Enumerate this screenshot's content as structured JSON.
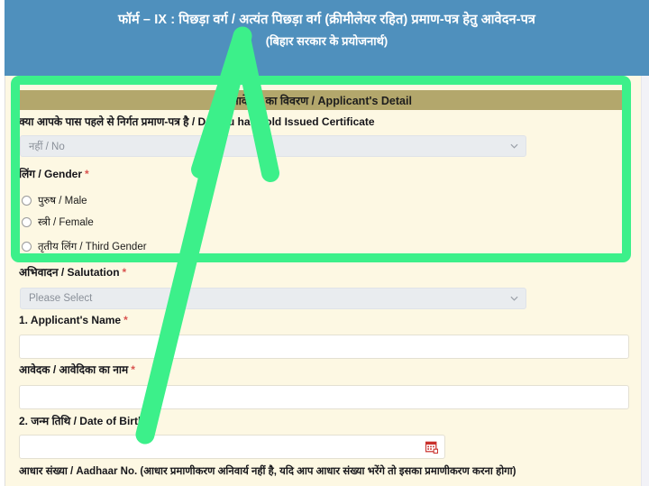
{
  "banner": {
    "title_line1": "फॉर्म – IX : पिछड़ा वर्ग / अत्यंत पिछड़ा वर्ग (क्रीमीलेयर रहित) प्रमाण-पत्र हेतु आवेदन-पत्र",
    "title_line2": "(बिहार सरकार के प्रयोजनार्थ)"
  },
  "section": {
    "header": "आवेदक का विवरण / Applicant's Detail"
  },
  "form": {
    "old_certificate": {
      "label": "क्या आपके पास पहले से निर्गत प्रमाण-पत्र है / Do you have old Issued Certificate",
      "value": "नहीं / No",
      "chevron_icon": "chevron-down-icon"
    },
    "gender": {
      "label": "लिंग / Gender",
      "required": "*",
      "options": [
        {
          "label": "पुरुष / Male",
          "selected": false
        },
        {
          "label": "स्त्री / Female",
          "selected": false
        },
        {
          "label": "तृतीय लिंग / Third Gender",
          "selected": false
        }
      ]
    },
    "salutation": {
      "label": "अभिवादन / Salutation",
      "required": "*",
      "value": "Please Select",
      "chevron_icon": "chevron-down-icon"
    },
    "applicant_name_en": {
      "label": "1. Applicant's Name",
      "required": "*",
      "value": ""
    },
    "applicant_name_hi": {
      "label": "आवेदक / आवेदिका का नाम",
      "required": "*",
      "value": ""
    },
    "date_of_birth": {
      "label": "2. जन्म तिथि / Date of Birth",
      "required": "*",
      "value": "",
      "calendar_icon": "calendar-icon"
    },
    "aadhaar_note": "आधार संख्या / Aadhaar No. (आधार प्रमाणीकरण अनिवार्य नहीं है, यदि आप आधार संख्या भरेंगे तो इसका प्रमाणीकरण करना होगा)"
  },
  "annotations": {
    "highlight_box": "green-highlight-rectangle",
    "arrow": "green-pointer-arrow"
  },
  "colors": {
    "banner_blue": "#4f90bd",
    "section_tan": "#b3a76c",
    "card_cream": "#fdf8e3",
    "annotation_green": "#3cf08a",
    "required_red": "#d9534f"
  }
}
